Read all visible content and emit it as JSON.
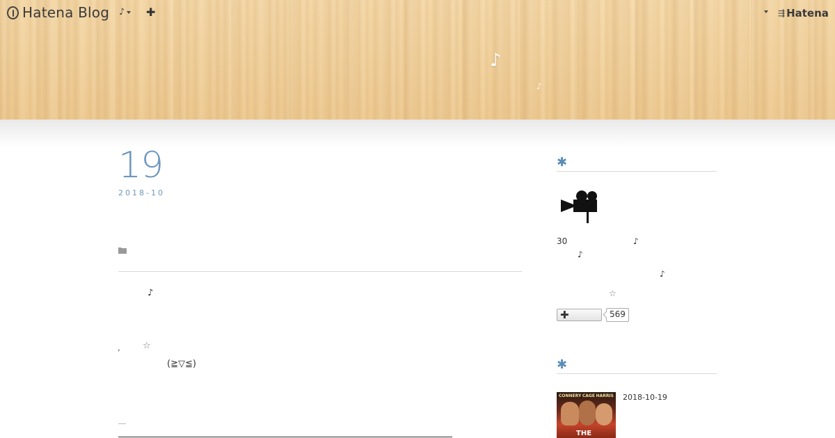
{
  "header": {
    "logo_text": "Hatena Blog",
    "menu_note": "♪",
    "plus": "✚",
    "hatena_text": "Hatena",
    "hero_note": "♪",
    "hero_note_small": "♪"
  },
  "entry": {
    "day": "19",
    "year_month": "2018-10",
    "note": "♪",
    "dot": ",",
    "star": "☆",
    "kaomoji": "(≧▽≦)"
  },
  "sidebar": {
    "section1": {
      "asterisk": "✱",
      "line1_num": "30",
      "line1_note": "♪",
      "line2_note": "♪",
      "line3_note": "♪",
      "star": "☆",
      "bookmark_plus": "✚",
      "bookmark_count": "569"
    },
    "section2": {
      "asterisk": "✱",
      "poster_names": [
        "CONNERY",
        "CAGE",
        "HARRIS"
      ],
      "poster_title": "THE",
      "recent_date": "2018-10-19"
    }
  },
  "icons": {
    "logo": "hatena-pen-icon",
    "folder": "folder-icon",
    "camera": "movie-camera-icon"
  },
  "colors": {
    "accent_blue": "#6e97bd",
    "asterisk_blue": "#5b8db8"
  }
}
